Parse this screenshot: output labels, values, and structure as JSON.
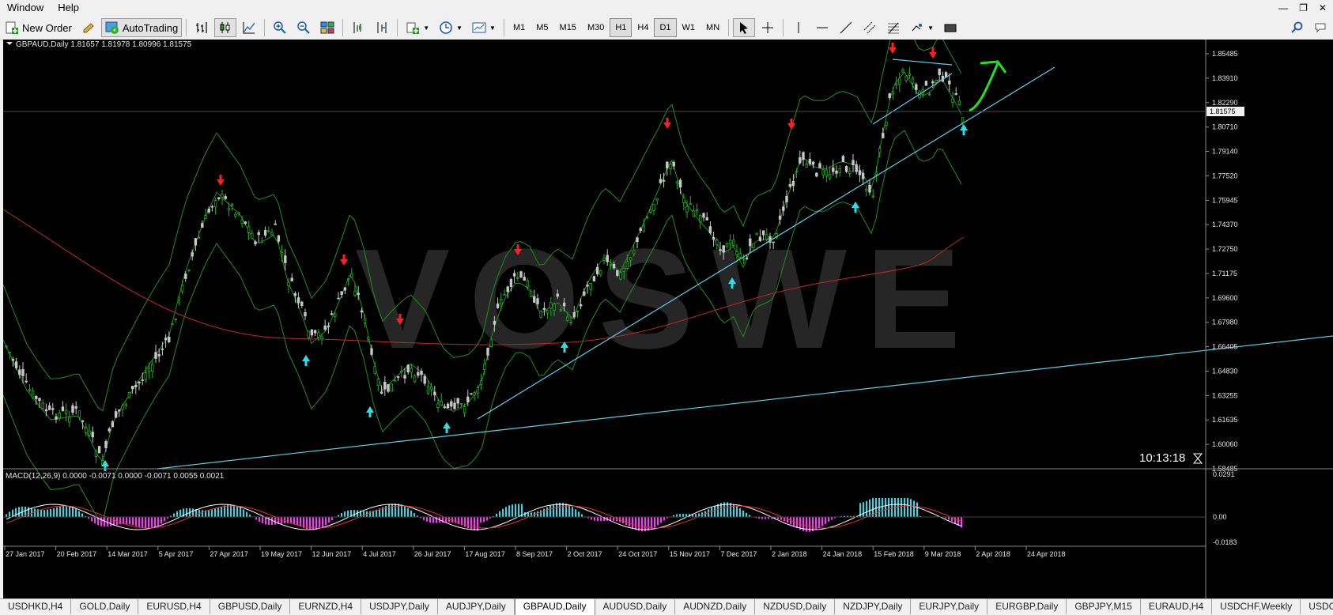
{
  "menu": [
    "Window",
    "Help"
  ],
  "toolbar": {
    "new_order": "New Order",
    "autotrading": "AutoTrading",
    "timeframes": [
      "M1",
      "M5",
      "M15",
      "M30",
      "H1",
      "H4",
      "D1",
      "W1",
      "MN"
    ],
    "active_timeframe": "H1"
  },
  "chart": {
    "header": "GBPAUD,Daily  1.81657 1.81978 1.80996 1.81575",
    "symbol": "GBPAUD",
    "timeframe": "Daily",
    "ohlc": [
      "1.81657",
      "1.81978",
      "1.80996",
      "1.81575"
    ],
    "current_price": "1.81575",
    "timer": "10:13:18",
    "watermark": "VOSWE",
    "price_labels": [
      "1.85485",
      "1.83910",
      "1.82290",
      "1.80710",
      "1.79140",
      "1.77520",
      "1.75945",
      "1.74370",
      "1.72750",
      "1.71175",
      "1.69600",
      "1.67980",
      "1.66405",
      "1.64830",
      "1.63255",
      "1.61635",
      "1.60060",
      "1.58485"
    ],
    "date_labels": [
      "27 Jan 2017",
      "20 Feb 2017",
      "14 Mar 2017",
      "5 Apr 2017",
      "27 Apr 2017",
      "19 May 2017",
      "12 Jun 2017",
      "4 Jul 2017",
      "26 Jul 2017",
      "17 Aug 2017",
      "8 Sep 2017",
      "2 Oct 2017",
      "24 Oct 2017",
      "15 Nov 2017",
      "7 Dec 2017",
      "2 Jan 2018",
      "24 Jan 2018",
      "15 Feb 2018",
      "9 Mar 2018",
      "2 Apr 2018",
      "24 Apr 2018"
    ],
    "colors": {
      "bull": "#22b022",
      "bear": "#c8c8c8",
      "bands": "#1f8f1f",
      "ma": "#c0282c",
      "trend": "#5bd0e6",
      "down_arrow": "#ff2020",
      "up_arrow": "#29e0e6"
    }
  },
  "macd": {
    "header": "MACD(12,26,9) 0.0000 -0.0071 0.0000 -0.0071 0.0055 0.0021",
    "labels": [
      "0.0291",
      "0.00",
      "-0.0183"
    ]
  },
  "tabs": [
    "USDHKD,H4",
    "GOLD,Daily",
    "EURUSD,H4",
    "GBPUSD,Daily",
    "EURNZD,H4",
    "USDJPY,Daily",
    "AUDJPY,Daily",
    "GBPAUD,Daily",
    "AUDUSD,Daily",
    "AUDNZD,Daily",
    "NZDUSD,Daily",
    "NZDJPY,Daily",
    "EURJPY,Daily",
    "EURGBP,Daily",
    "GBPJPY,M15",
    "EURAUD,H4",
    "USDCHF,Weekly",
    "USDCAD,Dai..."
  ],
  "active_tab": "GBPAUD,Daily"
}
